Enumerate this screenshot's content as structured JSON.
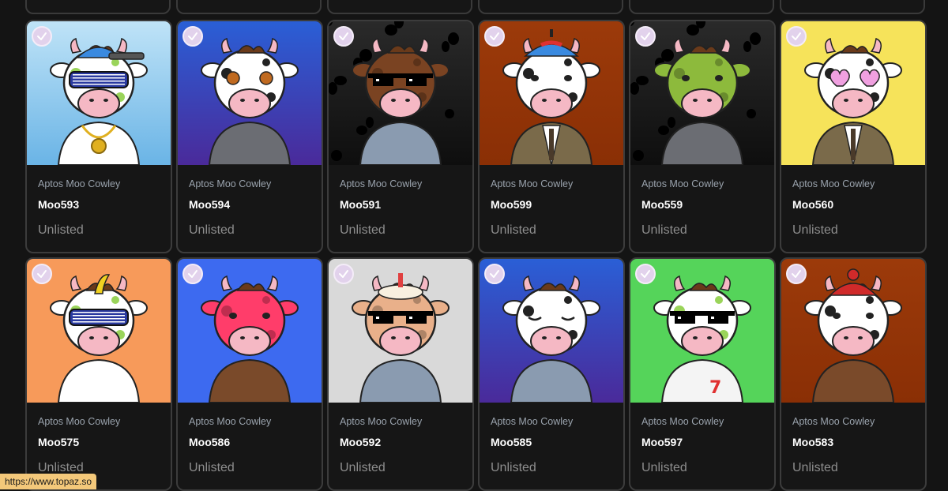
{
  "collection_label": "Aptos Moo Cowley",
  "status_url": "https://www.topaz.so",
  "cards": [
    {
      "name": "Moo593",
      "status": "Unlisted",
      "bg": "#bfe3f7",
      "bg2": "#6ab4e6",
      "body": "#ffffff",
      "accessory": "blue-shades-cap",
      "suit": "gold-chain"
    },
    {
      "name": "Moo594",
      "status": "Unlisted",
      "bg": "#2a5fd6",
      "bg2": "#4a2a9a",
      "body": "#ffffff",
      "accessory": "button-eyes",
      "suit": "kimono"
    },
    {
      "name": "Moo591",
      "status": "Unlisted",
      "bg": "#2a2a2a",
      "bg2": "#0e0e0e",
      "body": "#7a4322",
      "accessory": "pixel-shades",
      "suit": "armor"
    },
    {
      "name": "Moo599",
      "status": "Unlisted",
      "bg": "#9c3a0a",
      "bg2": "#8a2f05",
      "body": "#ffffff",
      "accessory": "propeller-cap",
      "suit": "brown-suit"
    },
    {
      "name": "Moo559",
      "status": "Unlisted",
      "bg": "#2a2a2a",
      "bg2": "#0e0e0e",
      "body": "#8dba3c",
      "accessory": "none",
      "suit": "kimono"
    },
    {
      "name": "Moo560",
      "status": "Unlisted",
      "bg": "#f6e35a",
      "bg2": "#f6e35a",
      "body": "#ffffff",
      "accessory": "heart-glasses",
      "suit": "brown-suit"
    },
    {
      "name": "Moo575",
      "status": "Unlisted",
      "bg": "#f79a5a",
      "bg2": "#f79a5a",
      "body": "#ffffff",
      "accessory": "blue-shades-banana",
      "suit": "none"
    },
    {
      "name": "Moo586",
      "status": "Unlisted",
      "bg": "#3d6af0",
      "bg2": "#3d6af0",
      "body": "#ff3d6a",
      "accessory": "none",
      "suit": "leather-jacket"
    },
    {
      "name": "Moo592",
      "status": "Unlisted",
      "bg": "#d9d9d9",
      "bg2": "#d9d9d9",
      "body": "#e9b08a",
      "accessory": "pixel-shades-cake",
      "suit": "armor"
    },
    {
      "name": "Moo585",
      "status": "Unlisted",
      "bg": "#2a5fd6",
      "bg2": "#4a2a9a",
      "body": "#ffffff",
      "accessory": "sleepy",
      "suit": "armor"
    },
    {
      "name": "Moo597",
      "status": "Unlisted",
      "bg": "#55d45a",
      "bg2": "#55d45a",
      "body": "#ffffff",
      "accessory": "pixel-shades",
      "suit": "jersey"
    },
    {
      "name": "Moo583",
      "status": "Unlisted",
      "bg": "#9c3a0a",
      "bg2": "#8a2f05",
      "body": "#ffffff",
      "accessory": "red-beanie",
      "suit": "leather-jacket"
    }
  ]
}
